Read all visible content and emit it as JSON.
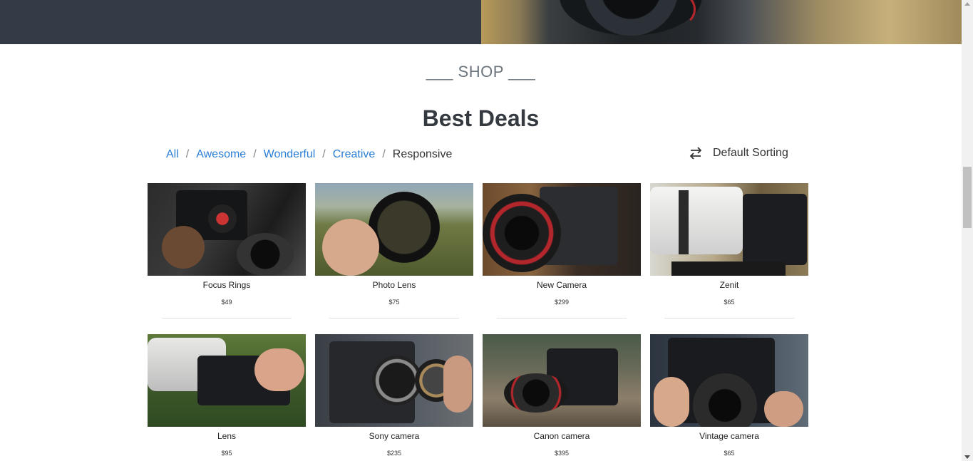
{
  "section": {
    "eyebrow": "___ SHOP ___",
    "title": "Best Deals"
  },
  "filters": {
    "items": [
      {
        "label": "All",
        "active": false
      },
      {
        "label": "Awesome",
        "active": false
      },
      {
        "label": "Wonderful",
        "active": false
      },
      {
        "label": "Creative",
        "active": false
      },
      {
        "label": "Responsive",
        "active": true
      }
    ],
    "separator": "/"
  },
  "sorting": {
    "label": "Default Sorting",
    "icon": "swap-arrows-icon"
  },
  "products": [
    {
      "name": "Focus Rings",
      "price": "$49"
    },
    {
      "name": "Photo Lens",
      "price": "$75"
    },
    {
      "name": "New Camera",
      "price": "$299"
    },
    {
      "name": "Zenit",
      "price": "$65"
    },
    {
      "name": "Lens",
      "price": "$95"
    },
    {
      "name": "Sony camera",
      "price": "$235"
    },
    {
      "name": "Canon camera",
      "price": "$395"
    },
    {
      "name": "Vintage camera",
      "price": "$65"
    }
  ],
  "colors": {
    "link": "#2b7ed6",
    "hero_dark": "#343a46",
    "title": "#343a40"
  }
}
